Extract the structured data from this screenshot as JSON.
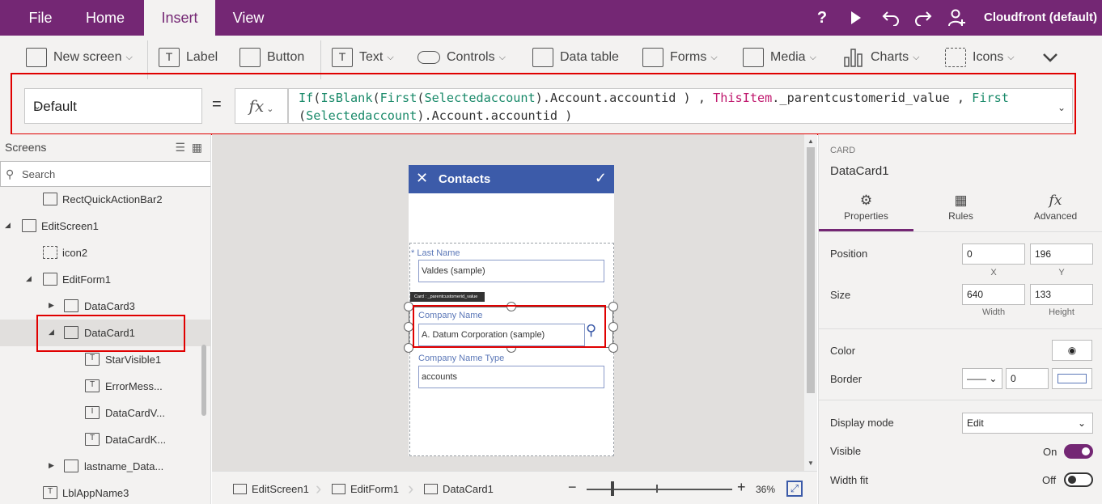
{
  "menu": {
    "tabs": [
      {
        "label": "File"
      },
      {
        "label": "Home"
      },
      {
        "label": "Insert"
      },
      {
        "label": "View"
      }
    ],
    "environment": "Cloudfront (default)",
    "icons": [
      "help-icon",
      "play-icon",
      "undo-icon",
      "redo-icon",
      "user-add-icon"
    ],
    "help_glyph": "?",
    "accent_color": "#742774"
  },
  "ribbon": {
    "new_screen": "New screen",
    "label": "Label",
    "button": "Button",
    "text": "Text",
    "controls": "Controls",
    "data_table": "Data table",
    "forms": "Forms",
    "media": "Media",
    "charts": "Charts",
    "icons": "Icons"
  },
  "formula_bar": {
    "property": "Default",
    "equals": "=",
    "fx": "fx",
    "expression": {
      "fn_if": "If",
      "fn_isblank": "IsBlank",
      "fn_first": "First",
      "arg_selectedaccount": "Selectedaccount",
      "path_account": ".Account.accountid",
      "keyword_thisitem": "ThisItem",
      "path_parent": "._parentcustomerid_value",
      "fn_first2": "First",
      "arg_selectedaccount2": "Selectedaccount",
      "path_account2": ".Account.accountid"
    }
  },
  "tree": {
    "header": "Screens",
    "search_placeholder": "Search",
    "nodes": [
      {
        "label": "RectQuickActionBar2"
      },
      {
        "label": "EditScreen1"
      },
      {
        "label": "icon2"
      },
      {
        "label": "EditForm1"
      },
      {
        "label": "DataCard3"
      },
      {
        "label": "DataCard1"
      },
      {
        "label": "StarVisible1"
      },
      {
        "label": "ErrorMess..."
      },
      {
        "label": "DataCardV..."
      },
      {
        "label": "DataCardK..."
      },
      {
        "label": "lastname_Data..."
      },
      {
        "label": "LblAppName3"
      }
    ]
  },
  "phone": {
    "title": "Contacts",
    "header_color": "#3c5ba9",
    "fields": [
      {
        "label": "Last Name",
        "required_mark": "*",
        "value": "Valdes (sample)"
      },
      {
        "label": "Company Name",
        "value": "A. Datum Corporation (sample)"
      },
      {
        "label": "Company Name Type",
        "value": "accounts"
      }
    ],
    "tooltip": "Card : _parentcustomerid_value"
  },
  "status_bar": {
    "crumbs": [
      "EditScreen1",
      "EditForm1",
      "DataCard1"
    ],
    "zoom_minus": "−",
    "zoom_plus": "+",
    "zoom": "36%"
  },
  "properties": {
    "category": "CARD",
    "name": "DataCard1",
    "tabs": [
      {
        "label": "Properties"
      },
      {
        "label": "Rules"
      },
      {
        "label": "Advanced"
      }
    ],
    "position_label": "Position",
    "position_x": "0",
    "position_y": "196",
    "x_label": "X",
    "y_label": "Y",
    "size_label": "Size",
    "width": "640",
    "height": "133",
    "width_label": "Width",
    "height_label": "Height",
    "color_label": "Color",
    "border_label": "Border",
    "border_width": "0",
    "display_mode_label": "Display mode",
    "display_mode": "Edit",
    "visible_label": "Visible",
    "visible_state": "On",
    "width_fit_label": "Width fit",
    "width_fit_state": "Off"
  }
}
